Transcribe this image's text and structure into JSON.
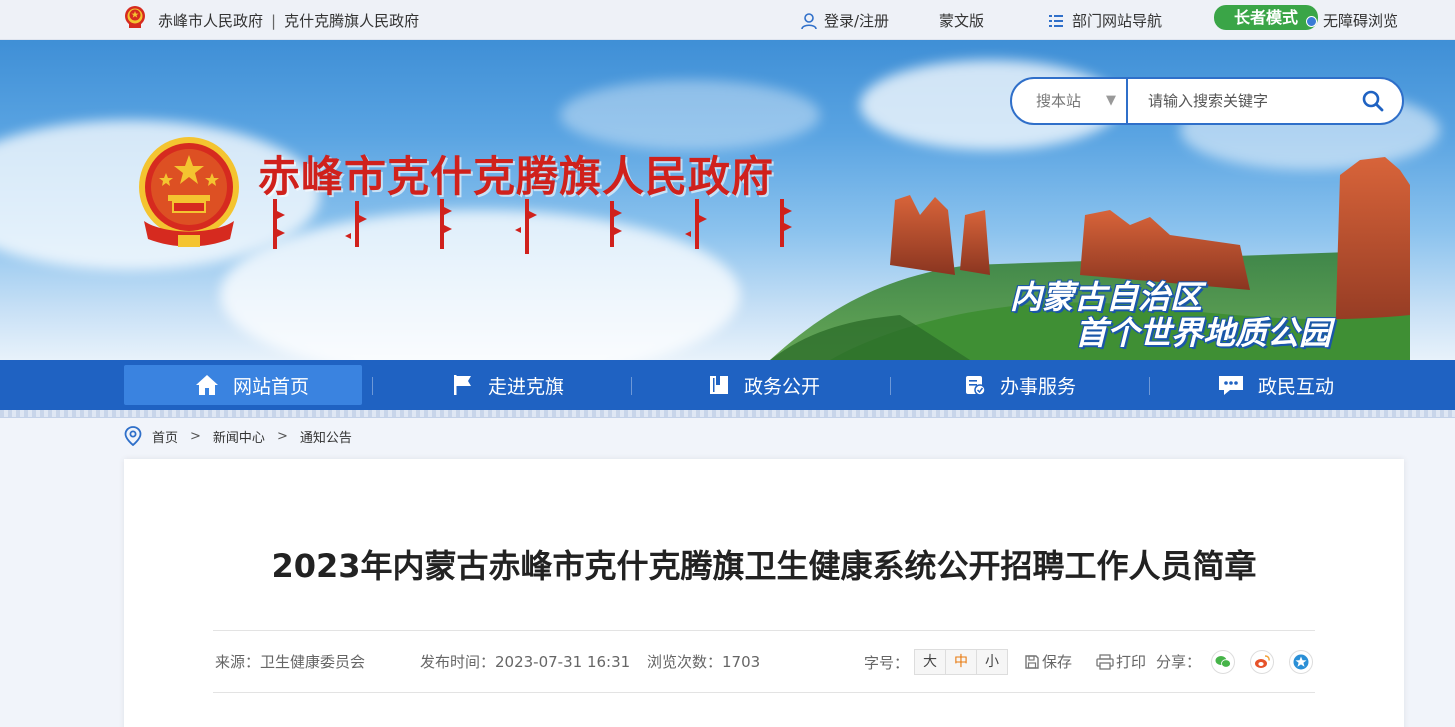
{
  "topbar": {
    "city_gov": "赤峰市人民政府",
    "separator": "|",
    "banner_gov": "克什克腾旗人民政府",
    "login": "登录/注册",
    "mongolian": "蒙文版",
    "dept_nav": "部门网站导航",
    "elder_mode": "长者模式",
    "accessibility": "无障碍浏览"
  },
  "banner": {
    "title": "赤峰市克什克腾旗人民政府",
    "slogan_line1": "内蒙古自治区",
    "slogan_line2": "首个世界地质公园"
  },
  "search": {
    "scope": "搜本站",
    "placeholder": "请输入搜索关键字"
  },
  "nav": {
    "items": [
      {
        "label": "网站首页",
        "icon": "home-icon"
      },
      {
        "label": "走进克旗",
        "icon": "flag-icon"
      },
      {
        "label": "政务公开",
        "icon": "book-icon"
      },
      {
        "label": "办事服务",
        "icon": "service-icon"
      },
      {
        "label": "政民互动",
        "icon": "chat-icon"
      }
    ]
  },
  "breadcrumb": {
    "items": [
      "首页",
      "新闻中心",
      "通知公告"
    ],
    "separator": ">"
  },
  "article": {
    "title": "2023年内蒙古赤峰市克什克腾旗卫生健康系统公开招聘工作人员简章",
    "source": "来源：卫生健康委员会",
    "publish_time": "发布时间：2023-07-31 16:31",
    "views": "浏览次数：1703",
    "font_size_label": "字号：",
    "font_large": "大",
    "font_medium": "中",
    "font_small": "小",
    "save": "保存",
    "print": "打印",
    "share_label": "分享："
  },
  "colors": {
    "nav_bg": "#1f62c2",
    "nav_active": "#3a83e0",
    "title_red": "#d0211c",
    "elder_green": "#3aa547"
  }
}
